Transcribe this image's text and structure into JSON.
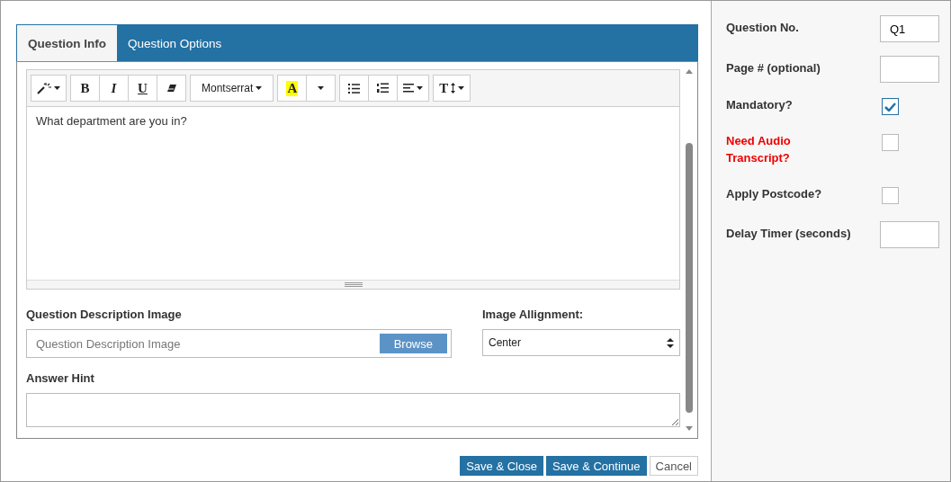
{
  "tabs": [
    {
      "label": "Question Info",
      "selected": true
    },
    {
      "label": "Question Options",
      "selected": false
    }
  ],
  "toolbar": [
    [
      {
        "kind": "magic"
      }
    ],
    [
      {
        "kind": "bold",
        "label": "B"
      },
      {
        "kind": "italic",
        "label": "I"
      },
      {
        "kind": "underline",
        "label": "U"
      },
      {
        "kind": "eraser"
      }
    ],
    [
      {
        "kind": "font",
        "label": "Montserrat"
      }
    ],
    [
      {
        "kind": "color",
        "label": "A"
      },
      {
        "kind": "caret"
      }
    ],
    [
      {
        "kind": "bullets"
      },
      {
        "kind": "numbers"
      },
      {
        "kind": "align"
      }
    ],
    [
      {
        "kind": "size",
        "label": "T"
      }
    ]
  ],
  "editor": {
    "value": "What department are you in?"
  },
  "image_field": {
    "label": "Question Description Image",
    "placeholder": "Question Description Image",
    "button": "Browse"
  },
  "alignment": {
    "label": "Image Allignment:",
    "value": "Center"
  },
  "answer_hint": {
    "label": "Answer Hint"
  },
  "buttons": [
    {
      "label": "Save & Close",
      "kind": "primary"
    },
    {
      "label": "Save & Continue",
      "kind": "primary"
    },
    {
      "label": "Cancel",
      "kind": "plain"
    }
  ],
  "settings": [
    {
      "label": "Question No.",
      "kind": "text",
      "value": "Q1",
      "highlight": false
    },
    {
      "label": "Page # (optional)",
      "kind": "text",
      "highlight": false
    },
    {
      "label": "Mandatory?",
      "kind": "checkbox",
      "checked": true,
      "highlight": false
    },
    {
      "label": "Need Audio Transcript?",
      "kind": "checkbox",
      "checked": false,
      "highlight": true
    },
    {
      "label": "Apply Postcode?",
      "kind": "checkbox",
      "checked": false,
      "highlight": false
    },
    {
      "label": "Delay Timer (seconds)",
      "kind": "text",
      "highlight": false
    }
  ]
}
